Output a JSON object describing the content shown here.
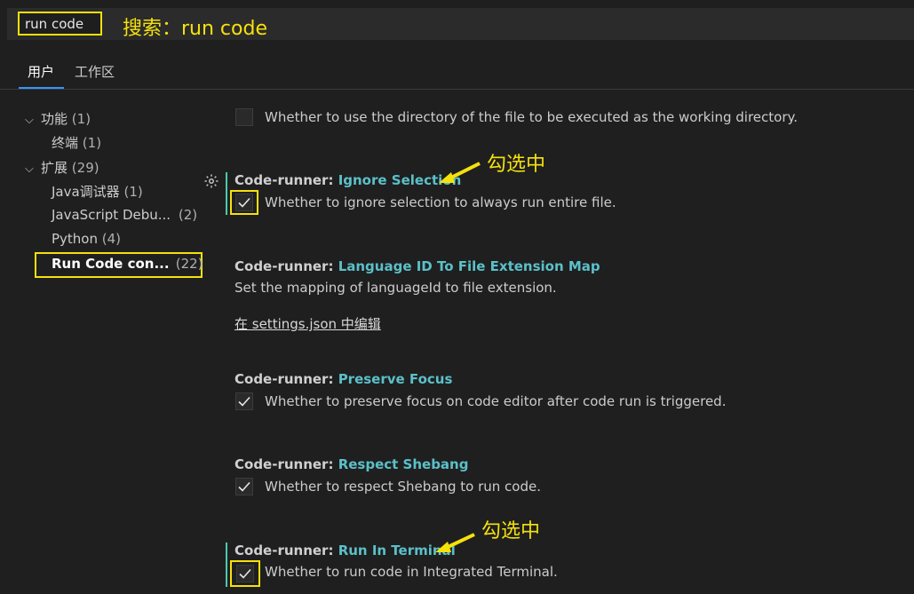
{
  "search": {
    "value": "run code"
  },
  "annotations": {
    "search_note": "搜索：run code",
    "checked_note_1": "勾选中",
    "checked_note_2": "勾选中"
  },
  "tabs": [
    {
      "label": "用户"
    },
    {
      "label": "工作区"
    }
  ],
  "tree": {
    "features": {
      "label": "功能",
      "count": "(1)"
    },
    "terminal": {
      "label": "终端",
      "count": "(1)"
    },
    "extensions": {
      "label": "扩展",
      "count": "(29)"
    },
    "java_debugger": {
      "label": "Java调试器",
      "count": "(1)"
    },
    "js_debugger": {
      "label": "JavaScript Debu...",
      "count": "(2)"
    },
    "python": {
      "label": "Python",
      "count": "(4)"
    },
    "run_code": {
      "label": "Run Code con...",
      "count": "(22)"
    }
  },
  "settings": {
    "cwd": {
      "desc": "Whether to use the directory of the file to be executed as the working directory.",
      "checked": false
    },
    "ignore_selection": {
      "prefix": "Code-runner: ",
      "name": "Ignore Selection",
      "desc": "Whether to ignore selection to always run entire file.",
      "checked": true
    },
    "language_map": {
      "prefix": "Code-runner: ",
      "name": "Language ID To File Extension Map",
      "desc": "Set the mapping of languageId to file extension.",
      "link": "在 settings.json 中编辑"
    },
    "preserve_focus": {
      "prefix": "Code-runner: ",
      "name": "Preserve Focus",
      "desc": "Whether to preserve focus on code editor after code run is triggered.",
      "checked": true
    },
    "respect_shebang": {
      "prefix": "Code-runner: ",
      "name": "Respect Shebang",
      "desc": "Whether to respect Shebang to run code.",
      "checked": true
    },
    "run_in_terminal": {
      "prefix": "Code-runner: ",
      "name": "Run In Terminal",
      "desc": "Whether to run code in Integrated Terminal.",
      "checked": true
    }
  },
  "colors": {
    "accent": "#5bc0c9",
    "highlight": "#f5e10c",
    "background": "#1f1f1f"
  }
}
